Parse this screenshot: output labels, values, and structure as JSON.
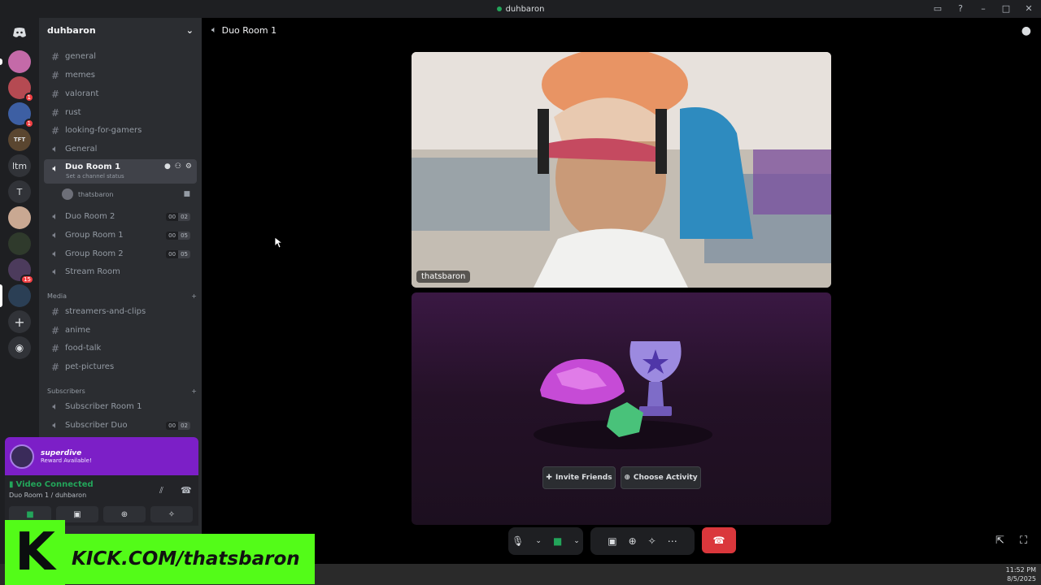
{
  "window": {
    "title": "duhbaron"
  },
  "server": {
    "name": "duhbaron"
  },
  "guilds": [
    {
      "badge": ""
    },
    {
      "badge": "1"
    },
    {
      "badge": "1"
    },
    {
      "label": "TFT",
      "badge": ""
    },
    {
      "label": "ltm",
      "badge": ""
    },
    {
      "label": "T",
      "badge": ""
    },
    {
      "badge": ""
    },
    {
      "badge": ""
    },
    {
      "badge": "15"
    },
    {
      "badge": ""
    }
  ],
  "channels": {
    "text1": [
      "general",
      "memes",
      "valorant",
      "rust",
      "looking-for-gamers"
    ],
    "voice_general": "General",
    "active_voice": {
      "name": "Duo Room 1",
      "status": "Set a channel status"
    },
    "vc_user": "thatsbaron",
    "voice_rooms": [
      {
        "name": "Duo Room 2",
        "count": [
          "00",
          "02"
        ]
      },
      {
        "name": "Group Room 1",
        "count": [
          "00",
          "05"
        ]
      },
      {
        "name": "Group Room 2",
        "count": [
          "00",
          "05"
        ]
      },
      {
        "name": "Stream Room"
      }
    ],
    "media_category": "Media",
    "media": [
      "streamers-and-clips",
      "anime",
      "food-talk",
      "pet-pictures"
    ],
    "subs_category": "Subscribers",
    "subs": [
      {
        "name": "Subscriber Room 1"
      },
      {
        "name": "Subscriber Duo",
        "count": [
          "00",
          "02"
        ]
      }
    ]
  },
  "promo": {
    "title": "superdive",
    "subtitle": "Reward Available!"
  },
  "voice_panel": {
    "status": "Video Connected",
    "channel": "Duo Room 1 / duhbaron"
  },
  "main": {
    "header": "Duo Room 1",
    "tile_user": "thatsbaron",
    "invite_label": "Invite Friends",
    "activity_label": "Choose Activity"
  },
  "overlay": {
    "logo_letter": "K",
    "text": "KICK.COM/thatsbaron"
  },
  "clock": {
    "time": "11:52 PM",
    "date": "8/5/2025"
  },
  "colors": {
    "accent_green": "#23a55a",
    "kick_green": "#53fc18",
    "promo_purple": "#7c1fc7",
    "hangup_red": "#da373c"
  }
}
